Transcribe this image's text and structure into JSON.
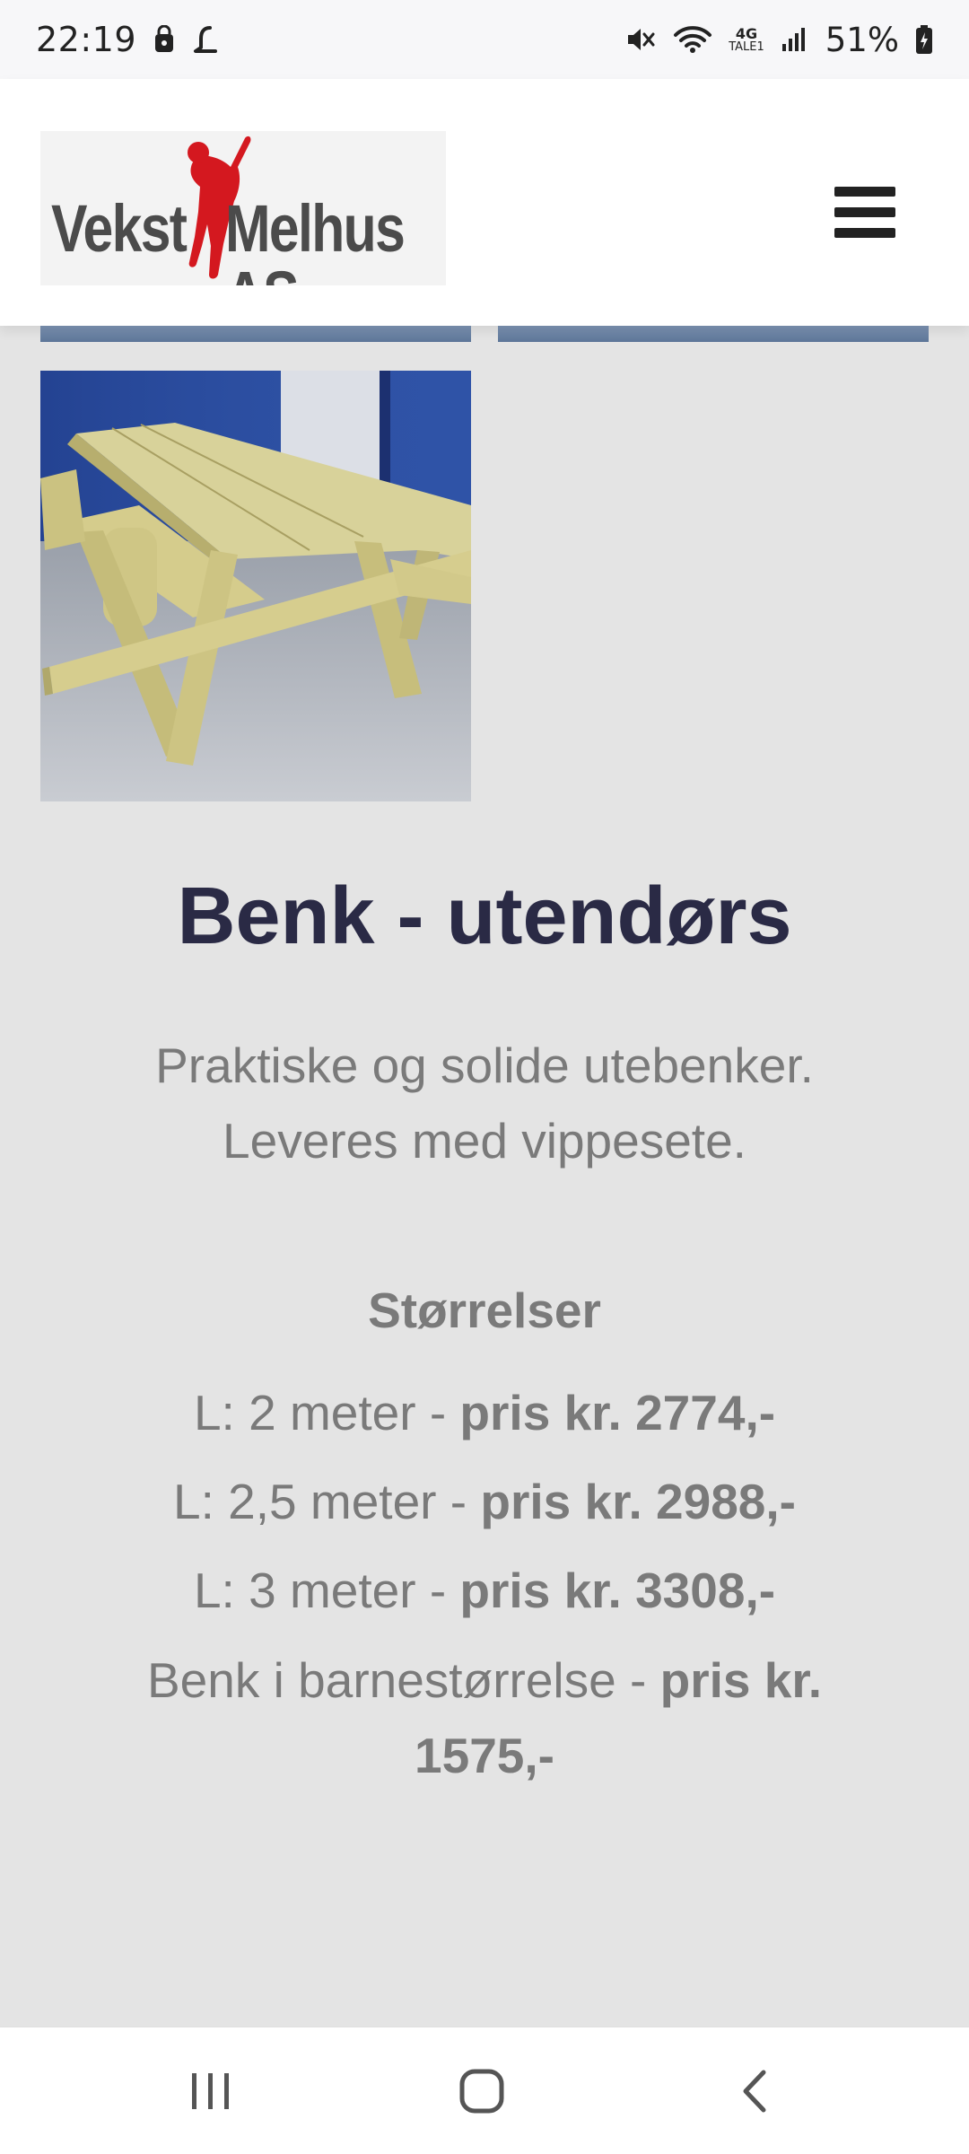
{
  "status_bar": {
    "time": "22:19",
    "network_label_top": "4G",
    "network_label_bottom": "TALE1",
    "battery_percent": "51%",
    "icons": [
      "lock-app-icon",
      "l-app-icon",
      "mute-icon",
      "wifi-icon",
      "signal-icon",
      "battery-icon"
    ]
  },
  "header": {
    "logo_word_1": "Vekst",
    "logo_word_2": "Melhus AS",
    "menu_icon": "hamburger-menu-icon"
  },
  "product": {
    "title": "Benk - utendørs",
    "description_line_1": "Praktiske og solide utebenker.",
    "description_line_2": "Leveres med vippesete.",
    "sizes_heading": "Størrelser",
    "prices": [
      {
        "label": "L: 2 meter - ",
        "price": "pris kr. 2774,-"
      },
      {
        "label": "L: 2,5 meter - ",
        "price": "pris kr. 2988,-"
      },
      {
        "label": "L: 3 meter - ",
        "price": "pris kr. 3308,-"
      },
      {
        "label": "Benk i barnestørrelse - ",
        "price": "pris kr. 1575,-"
      }
    ]
  },
  "colors": {
    "title": "#2a2a45",
    "body_text": "#7a7a7a",
    "page_background": "#e4e4e4",
    "logo_red": "#d4181f"
  },
  "nav_bar": {
    "icons": [
      "recent-apps-icon",
      "home-icon",
      "back-icon"
    ]
  }
}
